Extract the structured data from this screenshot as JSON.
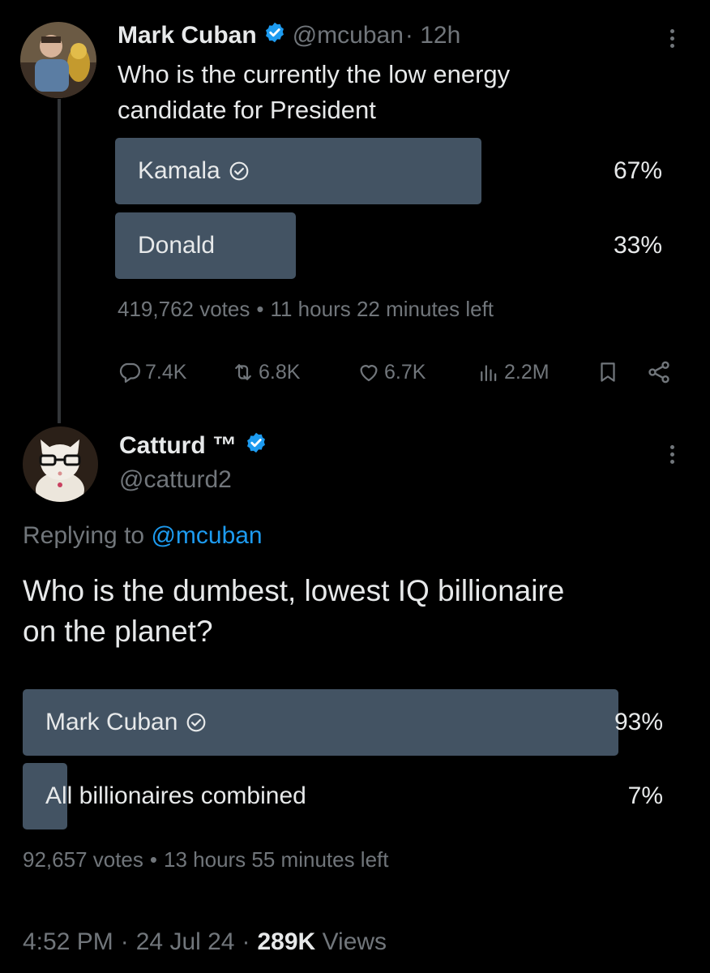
{
  "tweet1": {
    "name": "Mark Cuban",
    "handle": "@mcuban",
    "time": "· 12h",
    "text_line1": "Who is the currently the low energy",
    "text_line2": "candidate for President",
    "poll": {
      "options": [
        {
          "label": "Kamala",
          "percent": "67%",
          "fill": 0.67,
          "selected": true
        },
        {
          "label": "Donald",
          "percent": "33%",
          "fill": 0.33,
          "selected": false
        }
      ],
      "votes": "419,762 votes",
      "separator": "•",
      "time_left": "11 hours 22 minutes left"
    },
    "actions": {
      "replies": "7.4K",
      "reposts": "6.8K",
      "likes": "6.7K",
      "views": "2.2M"
    }
  },
  "tweet2": {
    "name": "Catturd ™",
    "handle": "@catturd2",
    "replying_prefix": "Replying to",
    "replying_handle": "@mcuban",
    "text_line1": "Who is the dumbest, lowest IQ billionaire",
    "text_line2": "on the planet?",
    "poll": {
      "options": [
        {
          "label": "Mark Cuban",
          "percent": "93%",
          "fill": 0.93,
          "selected": true
        },
        {
          "label": "All billionaires combined",
          "percent": "7%",
          "fill": 0.07,
          "selected": false
        }
      ],
      "votes": "92,657 votes",
      "separator": "•",
      "time_left": "13 hours 55 minutes left"
    },
    "footer": {
      "time": "4:52 PM",
      "dot1": "·",
      "date": "24 Jul 24",
      "dot2": "·",
      "views_count": "289K",
      "views_label": "Views"
    }
  },
  "colors": {
    "background": "#000000",
    "text": "#e7e9ea",
    "muted": "#71767b",
    "poll_fill": "#435363",
    "verified": "#1d9bf0",
    "link": "#1d9bf0"
  }
}
